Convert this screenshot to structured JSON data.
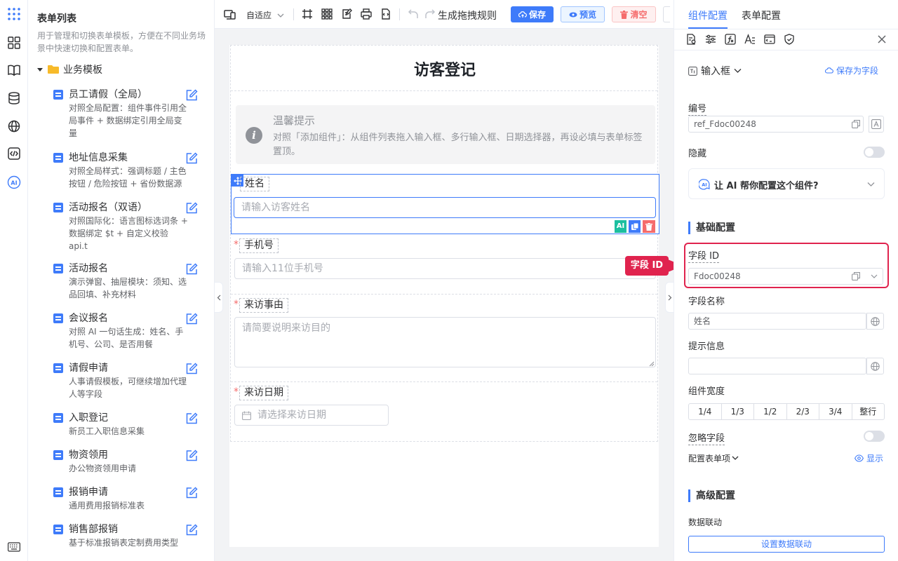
{
  "sidebar": {
    "title": "表单列表",
    "description": "用于管理和切换表单模板，方便在不同业务场景中快速切换和配置表单。",
    "folder": "业务模板",
    "templates": [
      {
        "name": "员工请假（全局）",
        "desc": "对照全局配置：组件事件引用全局事件 + 数据绑定引用全局变量"
      },
      {
        "name": "地址信息采集",
        "desc": "对照全局样式：强调标题 / 主色按钮 / 危险按钮 + 省份数据源"
      },
      {
        "name": "活动报名（双语）",
        "desc": "对照国际化：语言图标选词条 + 数据绑定 $t + 自定义校验 api.t"
      },
      {
        "name": "活动报名",
        "desc": "演示弹窗、抽屉模块：须知、选品回填、补充材料"
      },
      {
        "name": "会议报名",
        "desc": "对照 AI 一句话生成：姓名、手机号、公司、是否用餐"
      },
      {
        "name": "请假申请",
        "desc": "人事请假模板，可继续增加代理人等字段"
      },
      {
        "name": "入职登记",
        "desc": "新员工入职信息采集"
      },
      {
        "name": "物资领用",
        "desc": "办公物资领用申请"
      },
      {
        "name": "报销申请",
        "desc": "通用费用报销标准表"
      },
      {
        "name": "销售部报销",
        "desc": "基于标准报销表定制费用类型"
      }
    ]
  },
  "toolbar": {
    "device": "自适应",
    "rule_label": "生成拖拽规则",
    "save": "保存",
    "preview": "预览",
    "clear": "清空"
  },
  "form": {
    "title": "访客登记",
    "alert_title": "温馨提示",
    "alert_desc": "对照「添加组件」：从组件列表拖入输入框、多行输入框、日期选择器，再设必填与表单标签置顶。",
    "fields": [
      {
        "label": "姓名",
        "placeholder": "请输入访客姓名"
      },
      {
        "label": "手机号",
        "placeholder": "请输入11位手机号"
      },
      {
        "label": "来访事由",
        "placeholder": "请简要说明来访目的"
      },
      {
        "label": "来访日期",
        "placeholder": "请选择来访日期"
      }
    ]
  },
  "right": {
    "tabs": [
      "组件配置",
      "表单配置"
    ],
    "component_type": "输入框",
    "save_as_field": "保存为字段",
    "ref_label": "编号",
    "ref_value": "ref_Fdoc00248",
    "hidden_label": "隐藏",
    "ai_prompt": "让 AI 帮你配置这个组件?",
    "basic_section": "基础配置",
    "field_id_label": "字段 ID",
    "field_id_value": "Fdoc00248",
    "callout": "字段 ID",
    "field_name_label": "字段名称",
    "field_name_value": "姓名",
    "hint_label": "提示信息",
    "hint_value": "",
    "width_label": "组件宽度",
    "width_options": [
      "1/4",
      "1/3",
      "1/2",
      "2/3",
      "3/4",
      "整行"
    ],
    "ignore_label": "忽略字段",
    "form_items_label": "配置表单项",
    "show_label": "显示",
    "advanced_section": "高级配置",
    "linkage_label": "数据联动",
    "linkage_button": "设置数据联动"
  },
  "colors": {
    "primary": "#3e7bfa",
    "danger": "#f56c6c",
    "callout": "#e0234e",
    "ai_green": "#1cbfa0"
  }
}
